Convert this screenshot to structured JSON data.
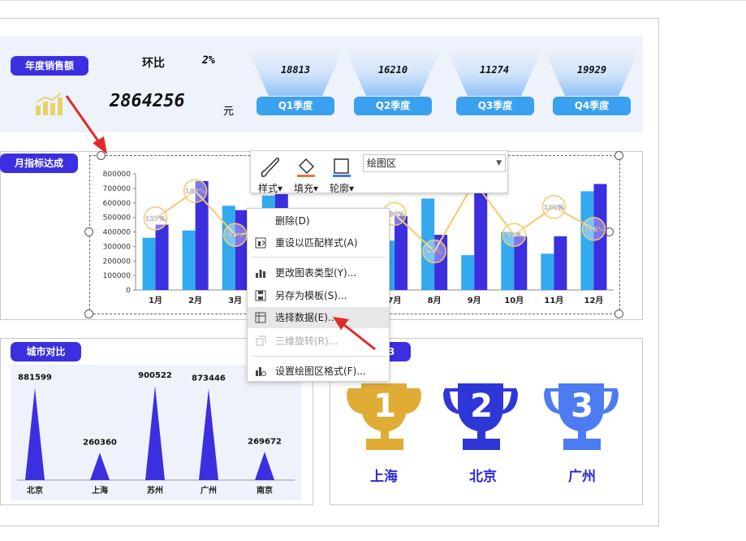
{
  "colors": {
    "accent": "#3b2fe0",
    "light_bar": "#33aaf0",
    "dark_bar": "#3b2fe0",
    "line": "#f5c96a",
    "gold": "#dfac35",
    "blue_dark": "#2f36d8",
    "blue_light": "#4d7bf0"
  },
  "header": {
    "annual_sales_label": "年度销售额",
    "ratio_label": "环比",
    "ratio_value": "2%",
    "total_sales": "2864256",
    "unit": "元",
    "quarters": [
      {
        "value": "18813",
        "label": "Q1季度"
      },
      {
        "value": "16210",
        "label": "Q2季度"
      },
      {
        "value": "11274",
        "label": "Q3季度"
      },
      {
        "value": "19929",
        "label": "Q4季度"
      }
    ]
  },
  "monthly": {
    "label": "月指标达成"
  },
  "chart_data": [
    {
      "type": "bar",
      "title": "",
      "categories": [
        "1月",
        "2月",
        "3月",
        "4月",
        "5月",
        "6月",
        "7月",
        "8月",
        "9月",
        "10月",
        "11月",
        "12月"
      ],
      "ylim": [
        0,
        800000
      ],
      "yticks": [
        "800000",
        "700000",
        "600000",
        "500000",
        "400000",
        "300000",
        "200000",
        "100000",
        "0"
      ],
      "series": [
        {
          "values": [
            360000,
            410000,
            580000,
            650000,
            310000,
            410000,
            340000,
            630000,
            240000,
            400000,
            250000,
            680000
          ]
        },
        {
          "values": [
            450000,
            750000,
            550000,
            660000,
            260000,
            430000,
            510000,
            380000,
            800000,
            370000,
            370000,
            730000
          ]
        },
        {
          "type": "line",
          "values": [
            1.27,
            1.82,
            0.94,
            1.05,
            1.2,
            1.36,
            1.36,
            0.61,
            2.0,
            0.94,
            1.5,
            1.06
          ],
          "labels": [
            "127%",
            "182%",
            "94%",
            "",
            "",
            "",
            "136%",
            "61%",
            "",
            "94%",
            "150%",
            "106%"
          ]
        }
      ]
    },
    {
      "type": "bar",
      "categories": [
        "北京",
        "上海",
        "苏州",
        "广州",
        "南京"
      ],
      "values": [
        881599,
        260360,
        900522,
        873446,
        269672
      ],
      "labels": [
        "881599",
        "260360",
        "900522",
        "873446",
        "269672"
      ]
    }
  ],
  "city": {
    "label": "城市对比"
  },
  "rank": {
    "badge_fragment": "3",
    "trophies": [
      {
        "num": "1",
        "city": "上海"
      },
      {
        "num": "2",
        "city": "北京"
      },
      {
        "num": "3",
        "city": "广州"
      }
    ]
  },
  "toolbar": {
    "style": "样式",
    "fill": "填充",
    "outline": "轮廓",
    "area_select": "绘图区"
  },
  "context_menu": {
    "items": [
      {
        "label": "删除(D)",
        "icon": "none"
      },
      {
        "label": "重设以匹配样式(A)",
        "icon": "reset-style-icon"
      },
      {
        "label": "更改图表类型(Y)...",
        "icon": "chart-type-icon"
      },
      {
        "label": "另存为模板(S)...",
        "icon": "save-template-icon"
      },
      {
        "label": "选择数据(E)...",
        "icon": "select-data-icon"
      },
      {
        "label": "三维旋转(R)...",
        "icon": "rotate-3d-icon"
      },
      {
        "label": "设置绘图区格式(F)...",
        "icon": "format-area-icon"
      }
    ]
  }
}
